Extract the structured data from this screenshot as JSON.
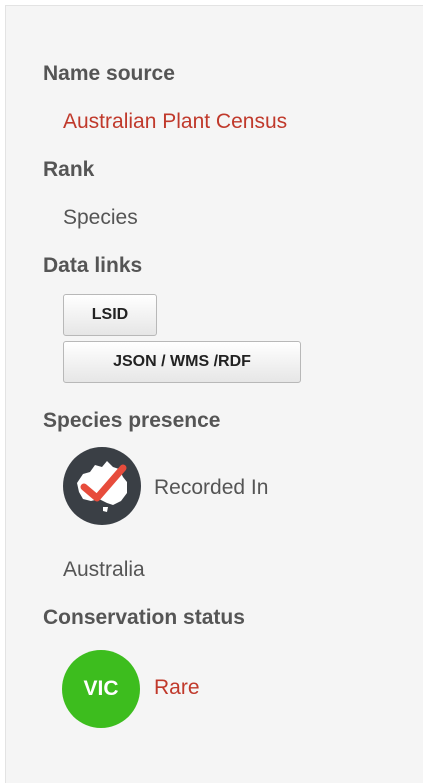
{
  "name_source": {
    "heading": "Name source",
    "value": "Australian Plant Census"
  },
  "rank": {
    "heading": "Rank",
    "value": "Species"
  },
  "data_links": {
    "heading": "Data links",
    "buttons": [
      "LSID",
      "JSON / WMS /RDF"
    ]
  },
  "species_presence": {
    "heading": "Species presence",
    "icon": "australia-check-icon",
    "label": "Recorded In",
    "region": "Australia"
  },
  "conservation_status": {
    "heading": "Conservation status",
    "badge": "VIC",
    "badge_color": "#3dbd1e",
    "status": "Rare",
    "status_color": "#c0392b"
  }
}
